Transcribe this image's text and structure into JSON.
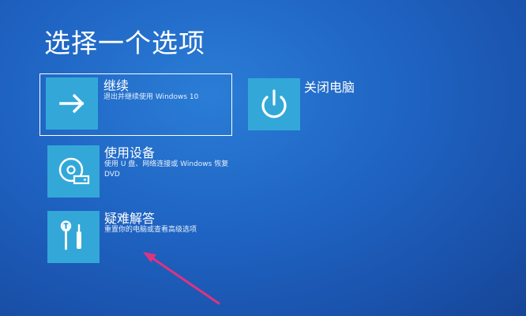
{
  "page": {
    "title": "选择一个选项"
  },
  "options": [
    {
      "label": "继续",
      "description": "退出并继续使用 Windows 10",
      "icon": "arrow-right-icon"
    },
    {
      "label": "关闭电脑",
      "description": "",
      "icon": "power-icon"
    },
    {
      "label": "使用设备",
      "description": "使用 U 盘、网络连接或 Windows 恢复 DVD",
      "icon": "disc-drive-icon"
    },
    {
      "label": "疑难解答",
      "description": "重置你的电脑或查看高级选项",
      "icon": "tools-icon"
    }
  ],
  "colors": {
    "background": "#1f63c2",
    "tile": "#33a8d8",
    "annotation_arrow": "#e0337f"
  }
}
